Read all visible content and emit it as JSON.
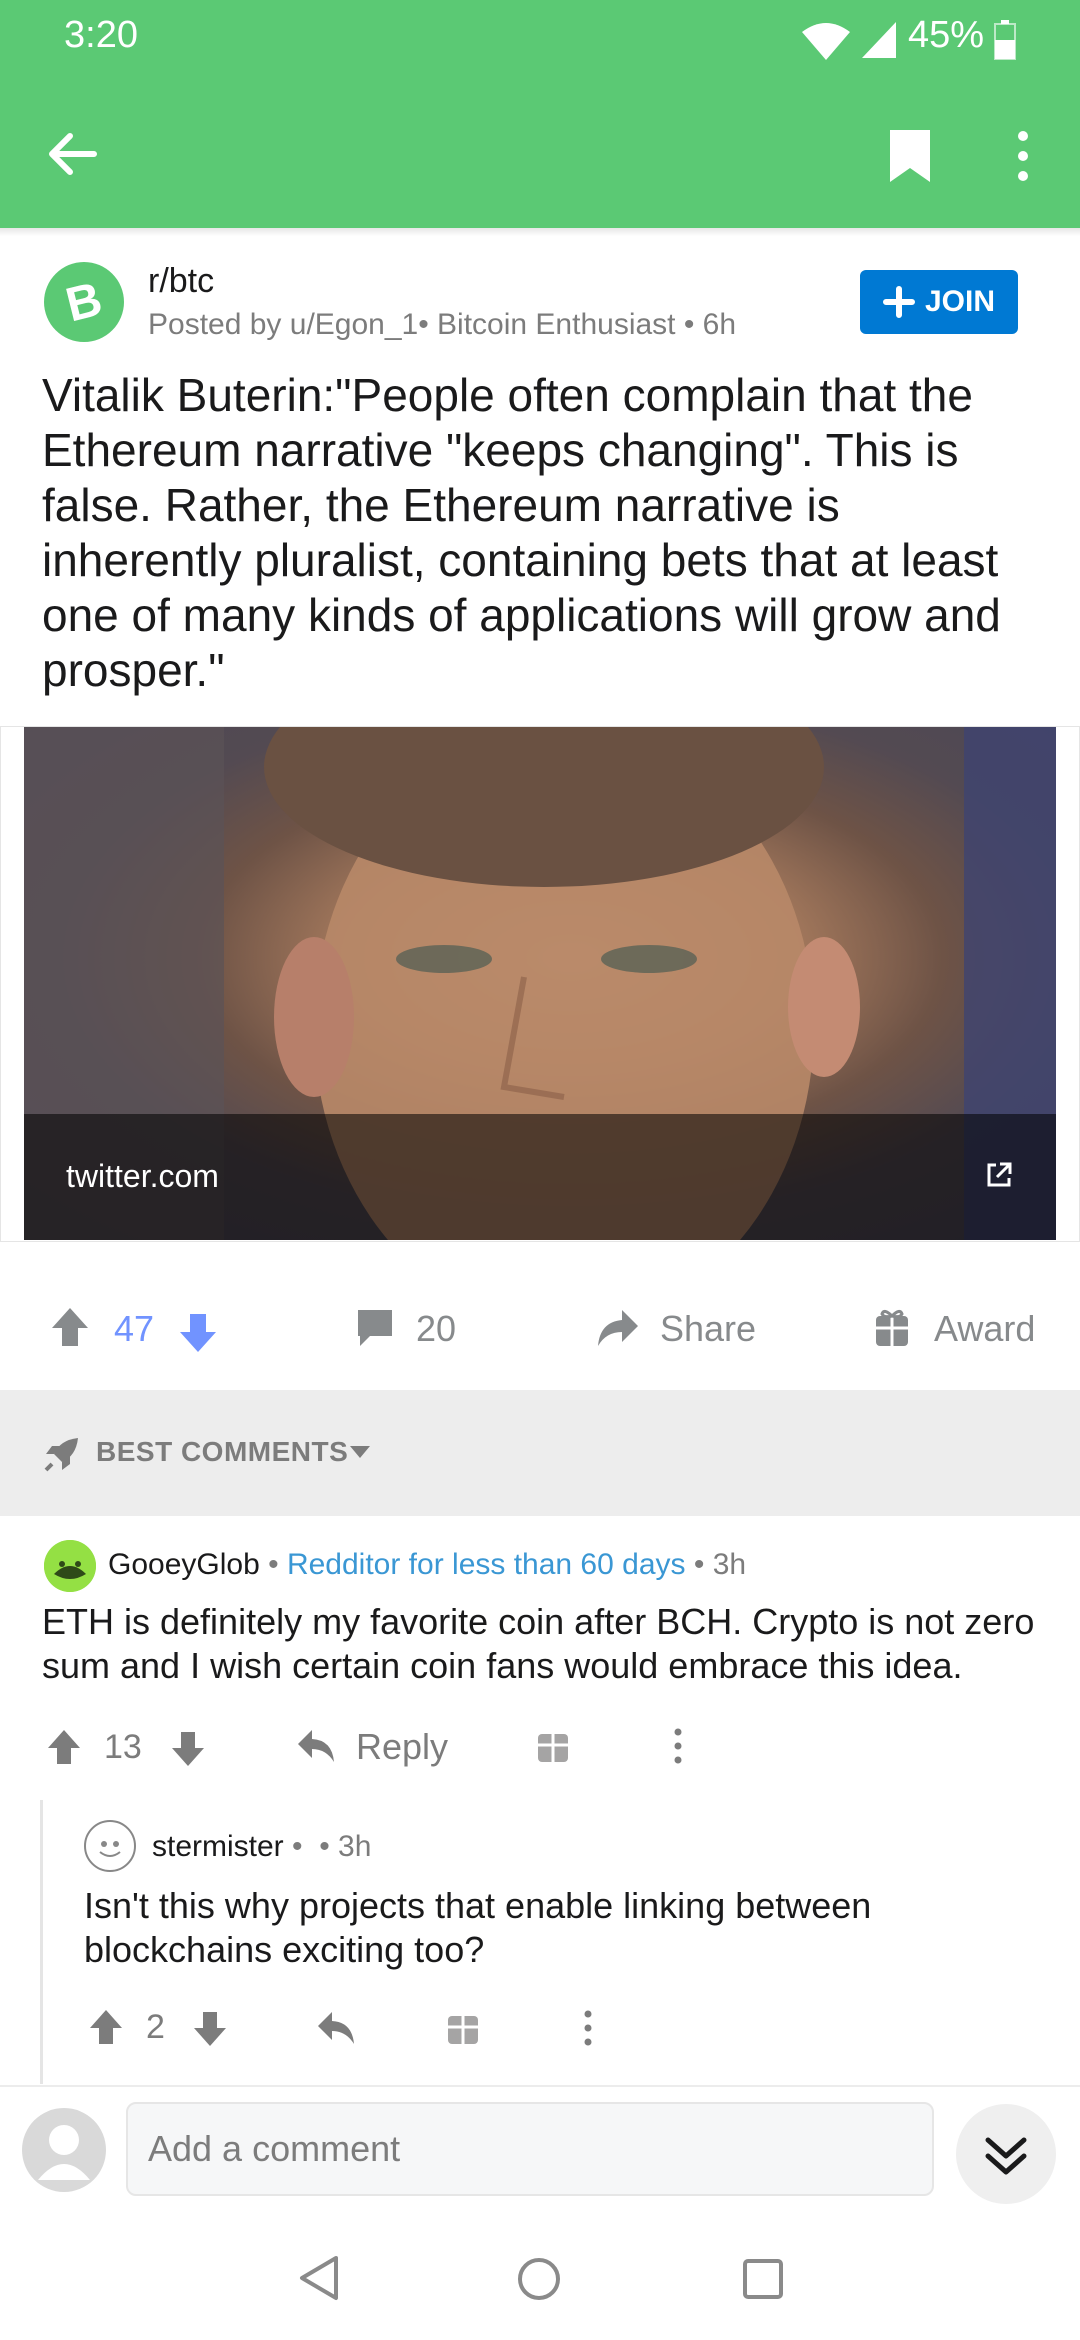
{
  "status_bar": {
    "time": "3:20",
    "battery": "45%"
  },
  "app_bar": {
    "icons": [
      "back-arrow-icon",
      "bookmark-icon",
      "more-vert-icon"
    ]
  },
  "post": {
    "subreddit": "r/btc",
    "posted_by": "Posted by u/Egon_1• Bitcoin Enthusiast • 6h",
    "join_label": "JOIN",
    "title": "Vitalik Buterin:\"People often complain that the Ethereum narrative \"keeps changing\". This is false. Rather, the Ethereum narrative is inherently pluralist, containing bets that at least one of many kinds of applications will grow and prosper.\"",
    "link_domain": "twitter.com",
    "votes": "47",
    "comments": "20",
    "share_label": "Share",
    "award_label": "Award"
  },
  "sort": {
    "label": "BEST COMMENTS"
  },
  "comments": [
    {
      "user": "GooeyGlob",
      "flair": "Redditor for less than 60 days",
      "age": "3h",
      "body": "ETH is definitely my favorite coin after BCH. Crypto is not zero sum and I wish certain coin fans would embrace this idea.",
      "votes": "13",
      "reply_label": "Reply"
    },
    {
      "user": "stermister",
      "age": "3h",
      "body": "Isn't this why projects that enable linking between blockchains exciting too?",
      "votes": "2"
    }
  ],
  "composer": {
    "placeholder": "Add a comment"
  },
  "colors": {
    "brand_green": "#5bc974",
    "join_blue": "#0079d3",
    "upvoted_blue": "#7193ff",
    "flair_blue": "#3a97d4"
  }
}
